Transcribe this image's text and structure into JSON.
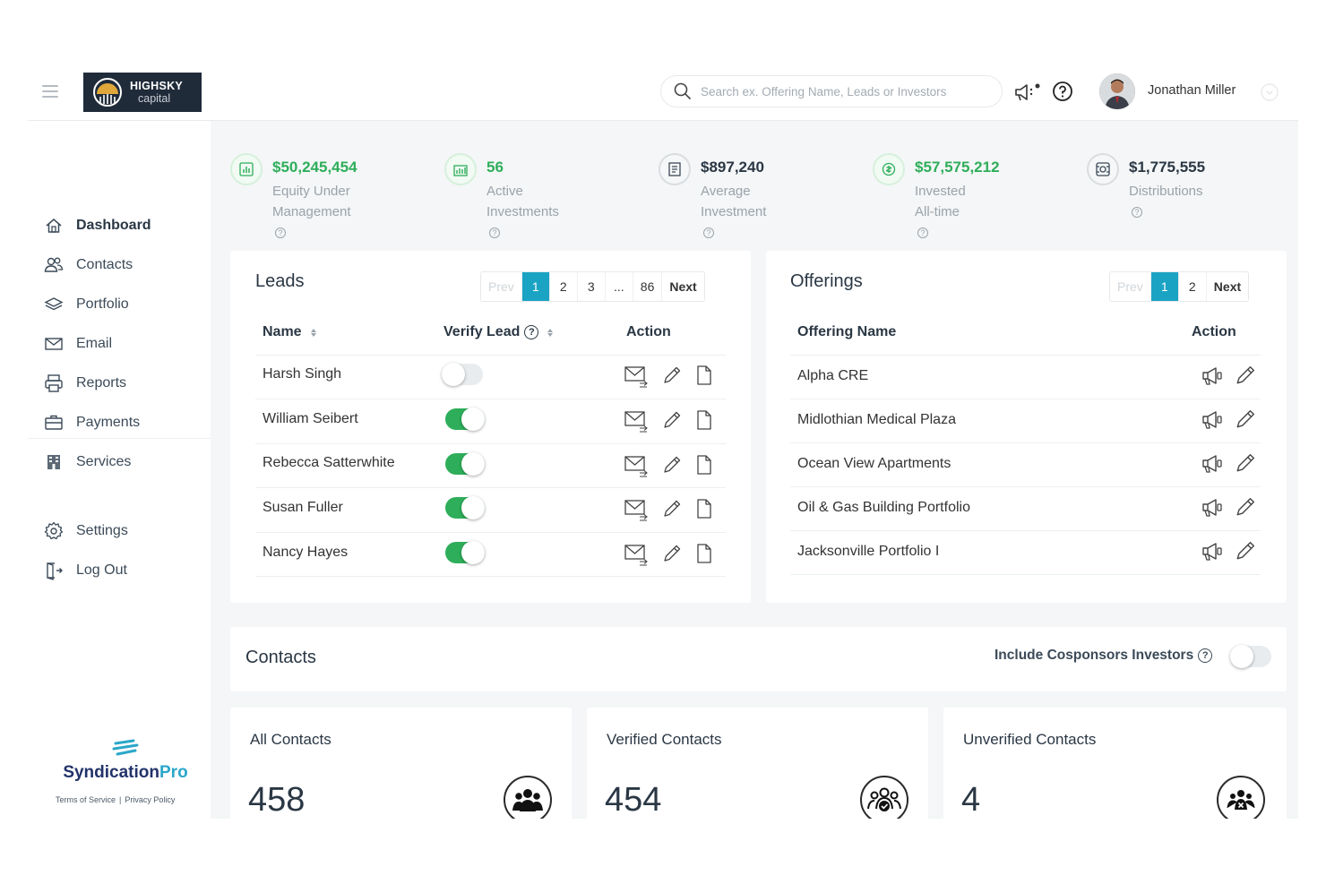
{
  "header": {
    "logo_line1": "HIGHSKY",
    "logo_line2": "capital",
    "search_placeholder": "Search ex. Offering Name, Leads or Investors",
    "user_name": "Jonathan Miller"
  },
  "sidebar": {
    "items": [
      {
        "label": "Dashboard",
        "icon": "home-icon",
        "active": true
      },
      {
        "label": "Contacts",
        "icon": "users-icon"
      },
      {
        "label": "Portfolio",
        "icon": "layers-icon"
      },
      {
        "label": "Email",
        "icon": "mail-icon"
      },
      {
        "label": "Reports",
        "icon": "printer-icon"
      },
      {
        "label": "Payments",
        "icon": "briefcase-icon"
      },
      {
        "label": "Services",
        "icon": "building-icon"
      }
    ],
    "bottom_items": [
      {
        "label": "Settings",
        "icon": "gear-icon"
      },
      {
        "label": "Log Out",
        "icon": "logout-icon"
      }
    ],
    "brand_name": "Syndication",
    "brand_suffix": "Pro",
    "terms": "Terms of Service",
    "privacy": "Privacy Policy"
  },
  "stats": [
    {
      "value": "$50,245,454",
      "label_line1": "Equity Under",
      "label_line2": "Management"
    },
    {
      "value": "56",
      "label_line1": "Active Investments",
      "label_line2": ""
    },
    {
      "value": "$897,240",
      "label_line1": "Average Investment",
      "label_line2": ""
    },
    {
      "value": "$57,575,212",
      "label_line1": "Invested All-time",
      "label_line2": ""
    },
    {
      "value": "$1,775,555",
      "label_line1": "Distributions",
      "label_line2": ""
    }
  ],
  "leads": {
    "title": "Leads",
    "pager": [
      "Prev",
      "1",
      "2",
      "3",
      "...",
      "86",
      "Next"
    ],
    "columns": {
      "name": "Name",
      "verify": "Verify Lead",
      "action": "Action"
    },
    "rows": [
      {
        "name": "Harsh Singh",
        "verified": false
      },
      {
        "name": "William Seibert",
        "verified": true
      },
      {
        "name": "Rebecca Satterwhite",
        "verified": true
      },
      {
        "name": "Susan Fuller",
        "verified": true
      },
      {
        "name": "Nancy Hayes",
        "verified": true
      }
    ]
  },
  "offerings": {
    "title": "Offerings",
    "pager": [
      "Prev",
      "1",
      "2",
      "Next"
    ],
    "columns": {
      "name": "Offering Name",
      "action": "Action"
    },
    "rows": [
      "Alpha CRE",
      "Midlothian Medical Plaza",
      "Ocean View Apartments",
      "Oil & Gas Building Portfolio",
      "Jacksonville Portfolio I"
    ]
  },
  "contacts": {
    "title": "Contacts",
    "cosponsor_label": "Include Cosponsors Investors",
    "cosponsor_on": false,
    "cards": [
      {
        "title": "All Contacts",
        "count": "458",
        "icon": "group-icon"
      },
      {
        "title": "Verified Contacts",
        "count": "454",
        "icon": "verified-group-icon"
      },
      {
        "title": "Unverified Contacts",
        "count": "4",
        "icon": "unverified-group-icon"
      }
    ]
  },
  "colors": {
    "accent": "#1ba3c3",
    "green": "#2eae5a",
    "navy": "#202b3a"
  }
}
